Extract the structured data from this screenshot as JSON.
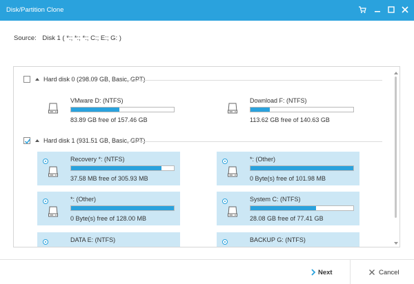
{
  "window": {
    "title": "Disk/Partition Clone",
    "accent": "#2aa2dd",
    "controls": [
      "cart-icon",
      "minimize-icon",
      "maximize-icon",
      "close-icon"
    ]
  },
  "source": {
    "label": "Source:",
    "value": "Disk 1 ( *:; *:; *:; C:; E:; G: )"
  },
  "disks": [
    {
      "label": "Hard disk 0 (298.09 GB, Basic, GPT)",
      "checked": false,
      "partitions": [
        {
          "name": "VMware D: (NTFS)",
          "free": "83.89 GB free of 157.46 GB",
          "used_fraction": 0.47,
          "selected": false
        },
        {
          "name": "Download F: (NTFS)",
          "free": "113.62 GB free of 140.63 GB",
          "used_fraction": 0.19,
          "selected": false
        }
      ]
    },
    {
      "label": "Hard disk 1 (931.51 GB, Basic, GPT)",
      "checked": true,
      "partitions": [
        {
          "name": "Recovery *: (NTFS)",
          "free": "37.58 MB free of 305.93 MB",
          "used_fraction": 0.88,
          "selected": true
        },
        {
          "name": "*: (Other)",
          "free": "0 Byte(s) free of 101.98 MB",
          "used_fraction": 1.0,
          "selected": true
        },
        {
          "name": "*: (Other)",
          "free": "0 Byte(s) free of 128.00 MB",
          "used_fraction": 1.0,
          "selected": true
        },
        {
          "name": "System C: (NTFS)",
          "free": "28.08 GB free of 77.41 GB",
          "used_fraction": 0.64,
          "selected": true
        },
        {
          "name": "DATA E: (NTFS)",
          "free": "",
          "used_fraction": 0,
          "selected": true
        },
        {
          "name": "BACKUP G: (NTFS)",
          "free": "",
          "used_fraction": 0,
          "selected": true
        }
      ]
    }
  ],
  "footer": {
    "next_label": "Next",
    "cancel_label": "Cancel"
  }
}
